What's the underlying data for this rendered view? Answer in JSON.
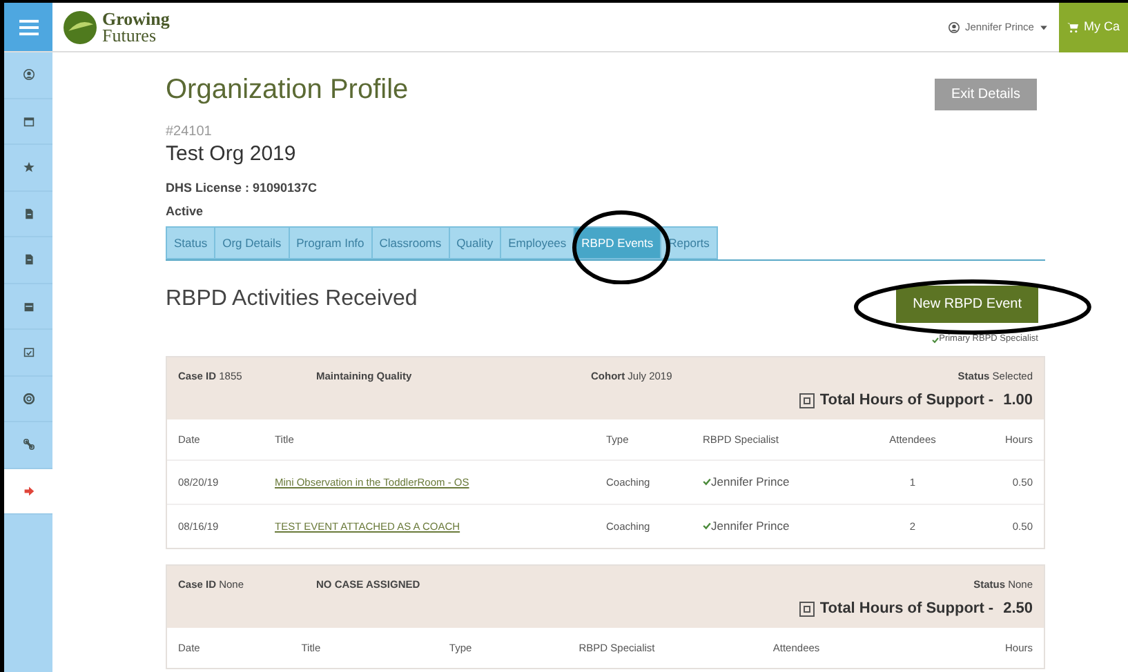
{
  "brand": {
    "line1": "Growing",
    "line2": "Futures"
  },
  "user_menu": {
    "name": "Jennifer Prince"
  },
  "cart_button": {
    "label": "My Ca"
  },
  "sidebar": {
    "items": [
      {
        "selected": false
      },
      {
        "selected": false
      },
      {
        "selected": false
      },
      {
        "selected": false
      },
      {
        "selected": false
      },
      {
        "selected": false
      },
      {
        "selected": false
      },
      {
        "selected": false
      },
      {
        "selected": false
      },
      {
        "selected": true
      }
    ]
  },
  "page_title": "Organization Profile",
  "exit_button": "Exit Details",
  "org": {
    "number": "#24101",
    "name": "Test Org 2019",
    "license": "DHS License : 91090137C",
    "status": "Active"
  },
  "tabs": [
    {
      "label": "Status",
      "selected": false
    },
    {
      "label": "Org Details",
      "selected": false
    },
    {
      "label": "Program Info",
      "selected": false
    },
    {
      "label": "Classrooms",
      "selected": false
    },
    {
      "label": "Quality",
      "selected": false
    },
    {
      "label": "Employees",
      "selected": false
    },
    {
      "label": "RBPD Events",
      "selected": true
    },
    {
      "label": "Reports",
      "selected": false
    }
  ],
  "section_title": "RBPD Activities Received",
  "new_button": "New RBPD Event",
  "legend": "Primary RBPD Specialist",
  "cases": [
    {
      "case_id_label": "Case ID",
      "case_id": "1855",
      "title": "Maintaining Quality",
      "cohort_label": "Cohort",
      "cohort": "July 2019",
      "status_label": "Status",
      "status": "Selected",
      "total_label": "Total Hours of Support -",
      "total_value": "1.00",
      "columns": [
        "Date",
        "Title",
        "Type",
        "RBPD Specialist",
        "Attendees",
        "Hours"
      ],
      "rows": [
        {
          "date": "08/20/19",
          "title": "Mini Observation in the ToddlerRoom - OS",
          "type": "Coaching",
          "specialist": "Jennifer Prince",
          "primary": true,
          "attendees": "1",
          "hours": "0.50"
        },
        {
          "date": "08/16/19",
          "title": "TEST EVENT ATTACHED AS A COACH",
          "type": "Coaching",
          "specialist": "Jennifer Prince",
          "primary": true,
          "attendees": "2",
          "hours": "0.50"
        }
      ]
    },
    {
      "case_id_label": "Case ID",
      "case_id": "None",
      "title": "NO CASE ASSIGNED",
      "status_label": "Status",
      "status": "None",
      "total_label": "Total Hours of Support -",
      "total_value": "2.50",
      "columns": [
        "Date",
        "Title",
        "Type",
        "RBPD Specialist",
        "Attendees",
        "Hours"
      ]
    }
  ]
}
